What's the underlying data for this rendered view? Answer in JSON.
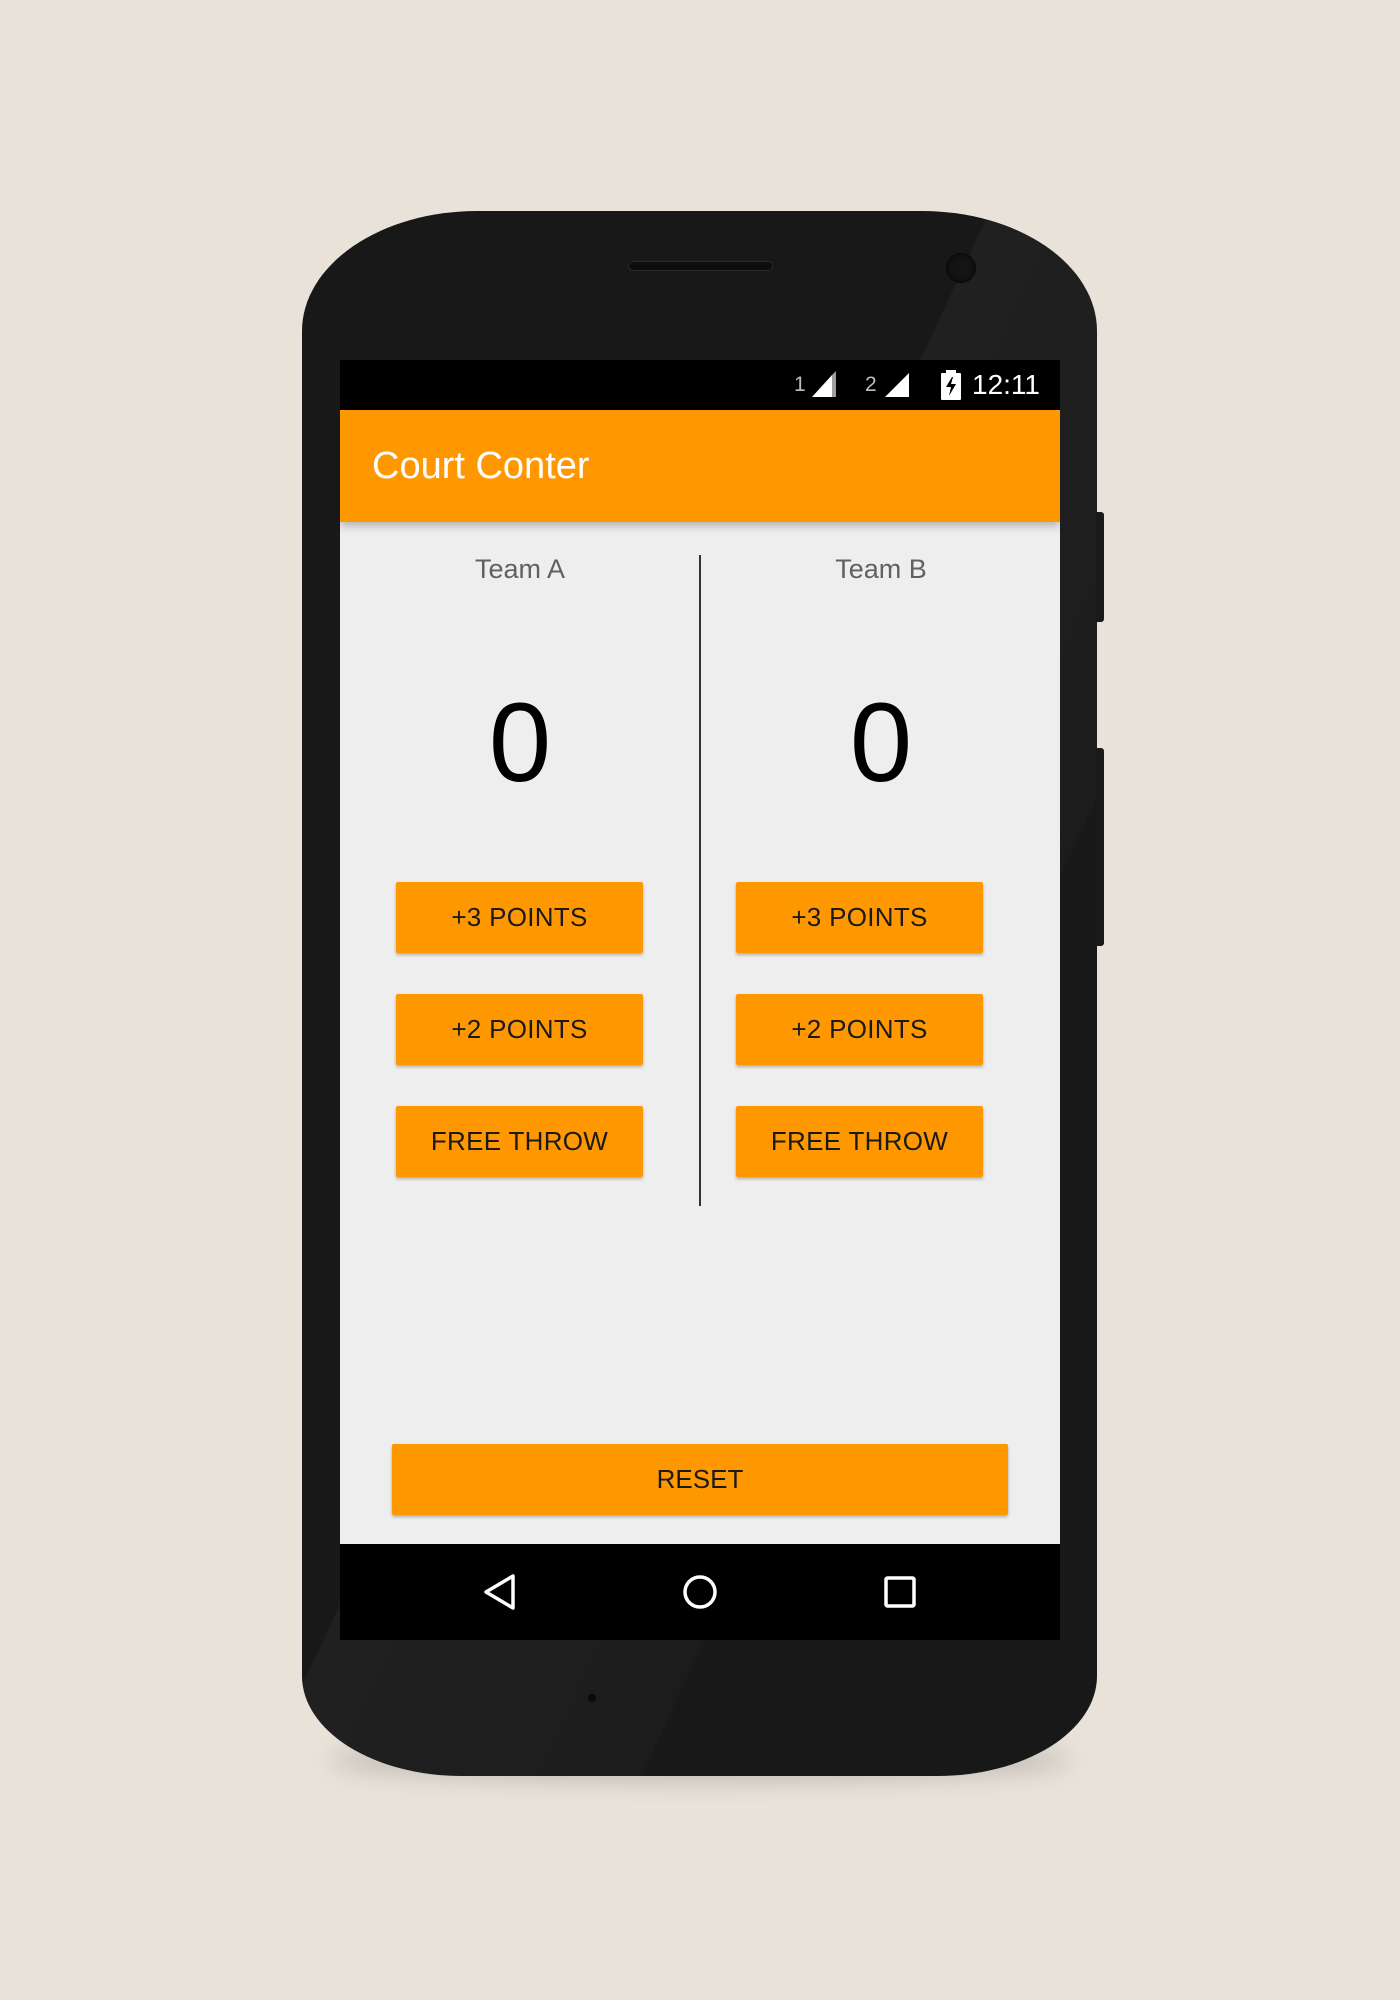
{
  "status_bar": {
    "sim1": "1",
    "sim2": "2",
    "time": "12:11",
    "signal1_icon": "signal-strength-icon",
    "signal2_icon": "signal-strength-icon",
    "battery_icon": "battery-charging-icon"
  },
  "app_bar": {
    "title": "Court Conter",
    "color": "#ff9800"
  },
  "team_a": {
    "name": "Team A",
    "score": "0",
    "buttons": {
      "three": "+3 POINTS",
      "two": "+2 POINTS",
      "free_throw": "FREE THROW"
    }
  },
  "team_b": {
    "name": "Team B",
    "score": "0",
    "buttons": {
      "three": "+3 POINTS",
      "two": "+2 POINTS",
      "free_throw": "FREE THROW"
    }
  },
  "reset": {
    "label": "RESET"
  },
  "nav_bar": {
    "back_icon": "back-triangle-icon",
    "home_icon": "home-circle-icon",
    "recents_icon": "recents-square-icon"
  },
  "colors": {
    "accent": "#ff9800",
    "background": "#eeeeee",
    "page_background": "#e8e2d9"
  }
}
